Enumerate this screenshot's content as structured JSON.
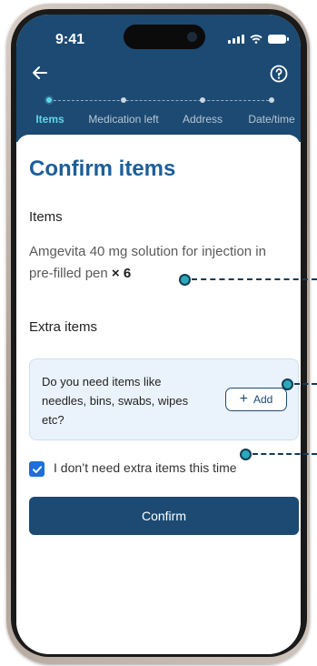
{
  "status_bar": {
    "time": "9:41"
  },
  "header": {
    "back_icon": "arrow-left-icon",
    "help_icon": "question-circle-icon",
    "steps": [
      {
        "label": "Items",
        "active": true
      },
      {
        "label": "Medication left",
        "active": false
      },
      {
        "label": "Address",
        "active": false
      },
      {
        "label": "Date/time",
        "active": false
      }
    ]
  },
  "page": {
    "title": "Confirm items",
    "items_heading": "Items",
    "item_name": "Amgevita 40 mg solution for injection in pre-filled pen",
    "item_qty": "× 6",
    "extra_heading": "Extra items",
    "extra_prompt": "Do you need items like needles, bins, swabs, wipes etc?",
    "add_label": "Add",
    "no_extra_label": "I don’t need extra items this time",
    "no_extra_checked": true,
    "confirm_label": "Confirm"
  },
  "colors": {
    "header_bg": "#1c4a72",
    "title_blue": "#1c5f99",
    "active_step": "#62d5e8",
    "checkbox": "#1e6fd9",
    "annotation": "#2aa9b8"
  }
}
